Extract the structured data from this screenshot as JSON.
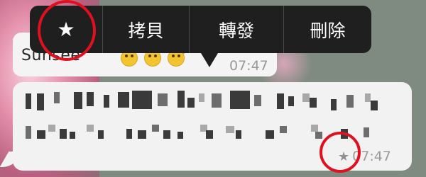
{
  "context_menu": {
    "star_icon": "★",
    "items": [
      "拷貝",
      "轉發",
      "刪除"
    ]
  },
  "upper_message": {
    "sender_name": "Sunsee",
    "time": "07:47"
  },
  "main_message": {
    "content_state": "pixelated/mosaic (unreadable)",
    "star_icon": "★",
    "time": "07:47"
  },
  "colors": {
    "menu_bg": "#1f1f1f",
    "bubble_bg": "#f2f2f2",
    "annotation_red": "#e0111e",
    "timestamp_grey": "#9a9a9a"
  }
}
